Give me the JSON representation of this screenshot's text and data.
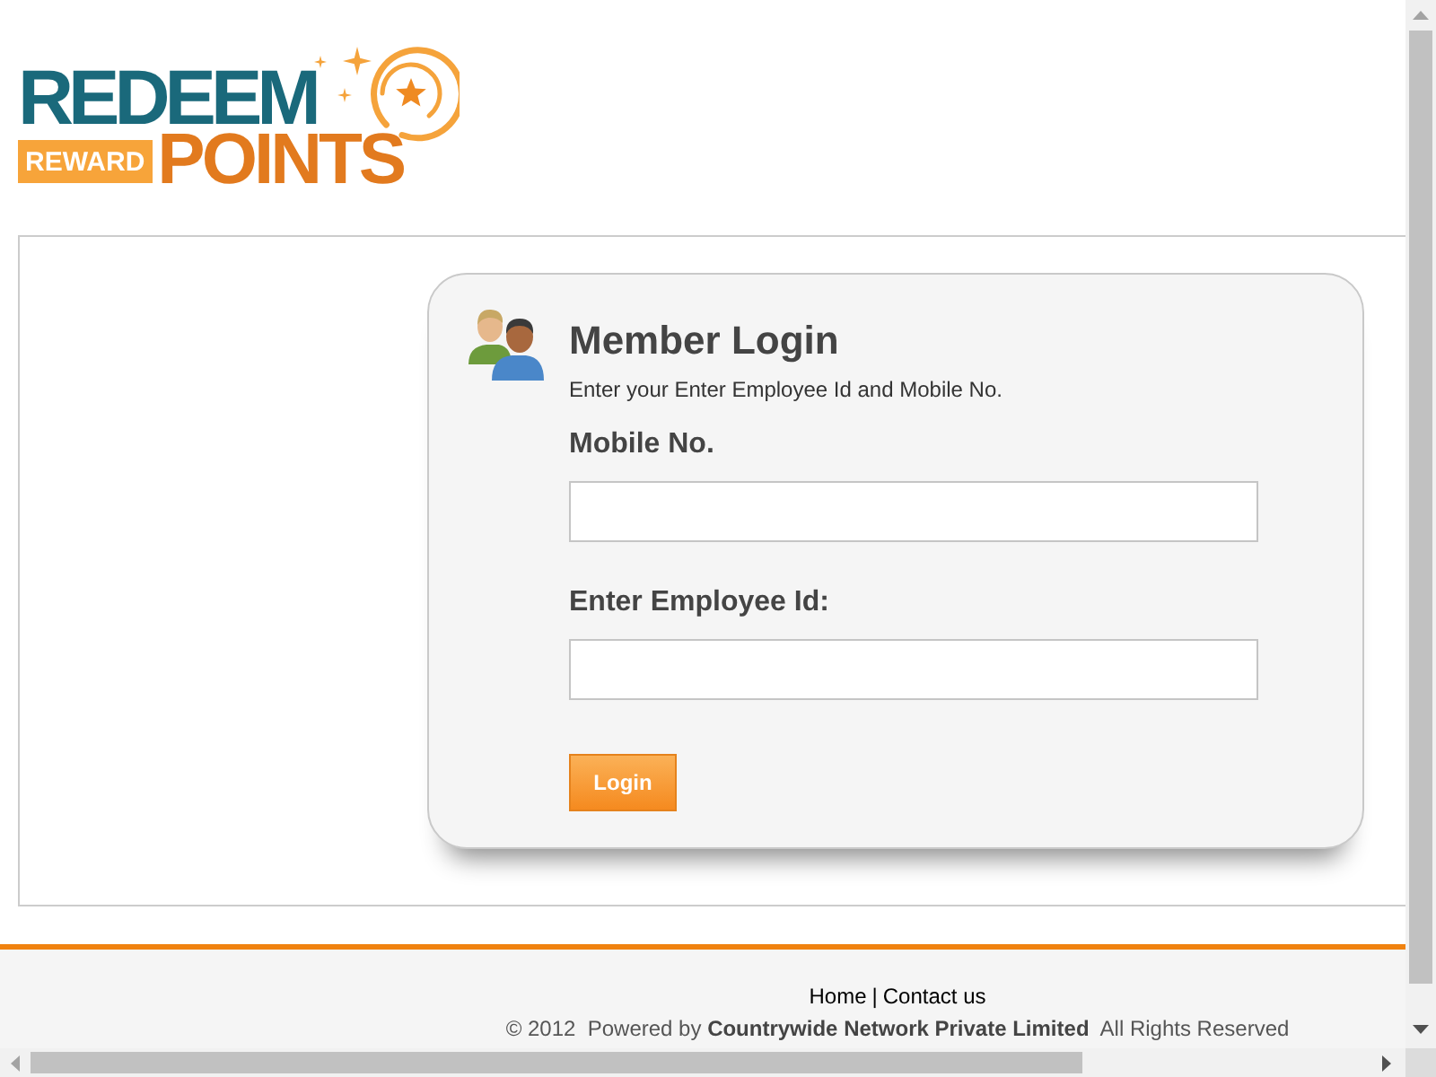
{
  "logo": {
    "top_word": "REDEEM",
    "tag": "REWARD",
    "bottom_word": "POINTS"
  },
  "login": {
    "title": "Member Login",
    "subtitle": "Enter your Enter Employee Id and Mobile No.",
    "fields": [
      {
        "label": "Mobile No."
      },
      {
        "label": "Enter Employee Id:"
      }
    ],
    "button": "Login"
  },
  "footer": {
    "links": [
      {
        "label": "Home"
      },
      {
        "label": "Contact us"
      }
    ],
    "separator": "|",
    "copyright": "© 2012  Powered by **Countrywide Network Private Limited**  All Rights Reserved"
  }
}
